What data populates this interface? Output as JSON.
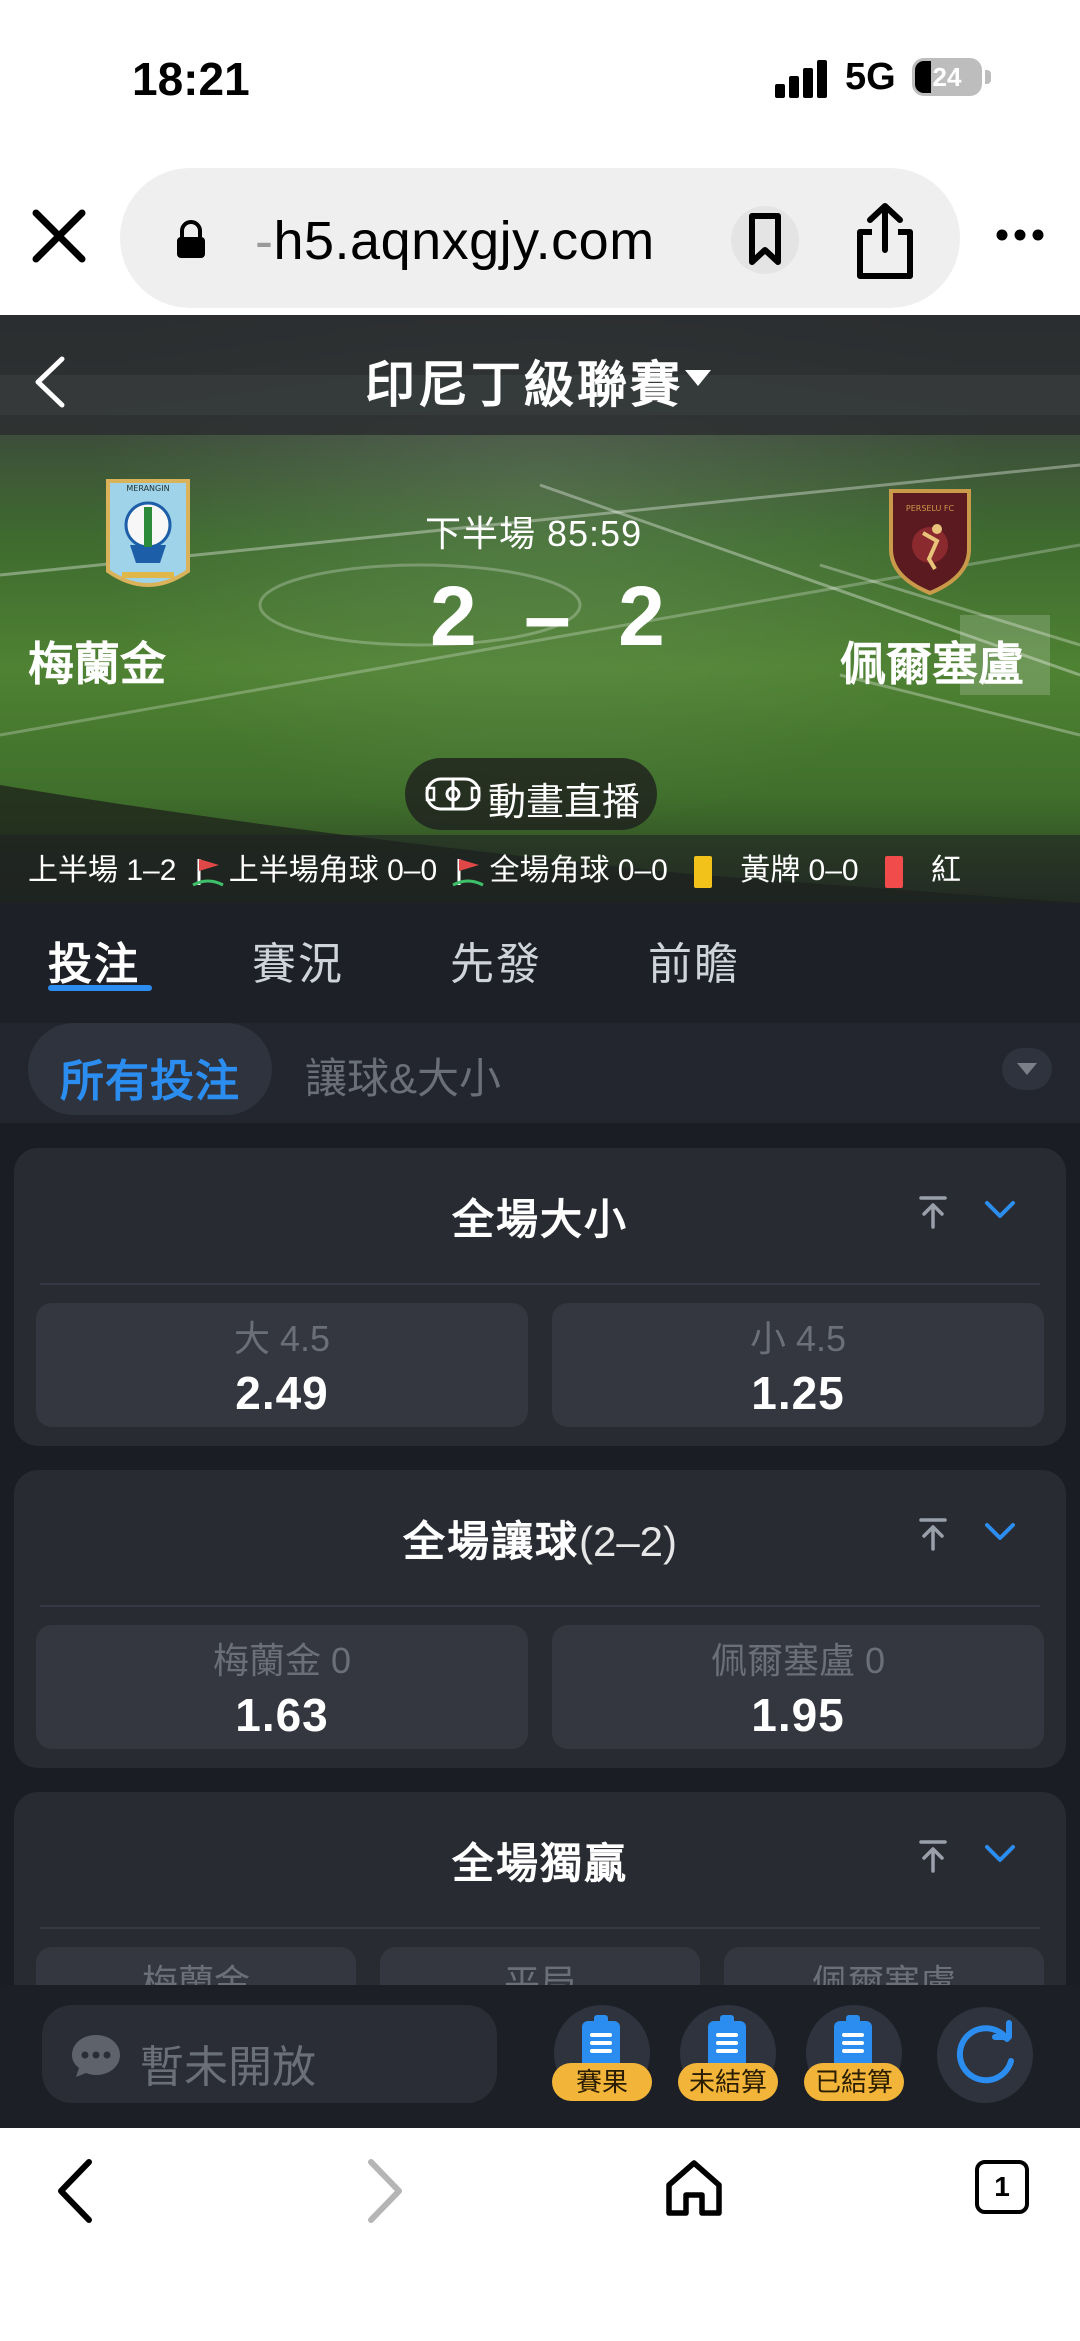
{
  "status_bar": {
    "time": "18:21",
    "network": "5G",
    "battery": "24"
  },
  "browser": {
    "url_faded": "-",
    "url": "h5.aqnxgjy.com"
  },
  "match": {
    "league": "印尼丁級聯賽",
    "period": "下半場 85:59",
    "score": "2 – 2",
    "home_team": "梅蘭金",
    "away_team": "佩爾塞盧",
    "live_button": "動畫直播",
    "home_logo_text": "MERANGIN",
    "away_logo_text": "PERSELU FC",
    "stats": {
      "first_half": "上半場 1–2",
      "first_half_corners": "上半場角球 0–0",
      "full_corners": "全場角球 0–0",
      "yellow": "黃牌 0–0",
      "red": "紅"
    }
  },
  "tabs": [
    "投注",
    "賽況",
    "先發",
    "前瞻"
  ],
  "filters": {
    "active": "所有投注",
    "other": "讓球&大小"
  },
  "markets": [
    {
      "title": "全場大小",
      "subtitle": "",
      "options": [
        {
          "label": "大 4.5",
          "odds": "2.49"
        },
        {
          "label": "小 4.5",
          "odds": "1.25"
        }
      ]
    },
    {
      "title": "全場讓球",
      "subtitle": "(2–2)",
      "options": [
        {
          "label": "梅蘭金 0",
          "odds": "1.63"
        },
        {
          "label": "佩爾塞盧 0",
          "odds": "1.95"
        }
      ]
    },
    {
      "title": "全場獨贏",
      "subtitle": "",
      "options": [
        {
          "label": "梅蘭金"
        },
        {
          "label": "平局"
        },
        {
          "label": "佩爾塞盧"
        }
      ]
    }
  ],
  "chat": {
    "placeholder": "暫未開放"
  },
  "dock_buttons": [
    "賽果",
    "未結算",
    "已結算"
  ],
  "bottom_nav": {
    "tab_count": "1"
  },
  "colors": {
    "accent": "#2c8df0",
    "card": "#292b33",
    "badge": "#f2b53a",
    "yellow_card": "#f2c21b",
    "red_card": "#f24b4b"
  }
}
